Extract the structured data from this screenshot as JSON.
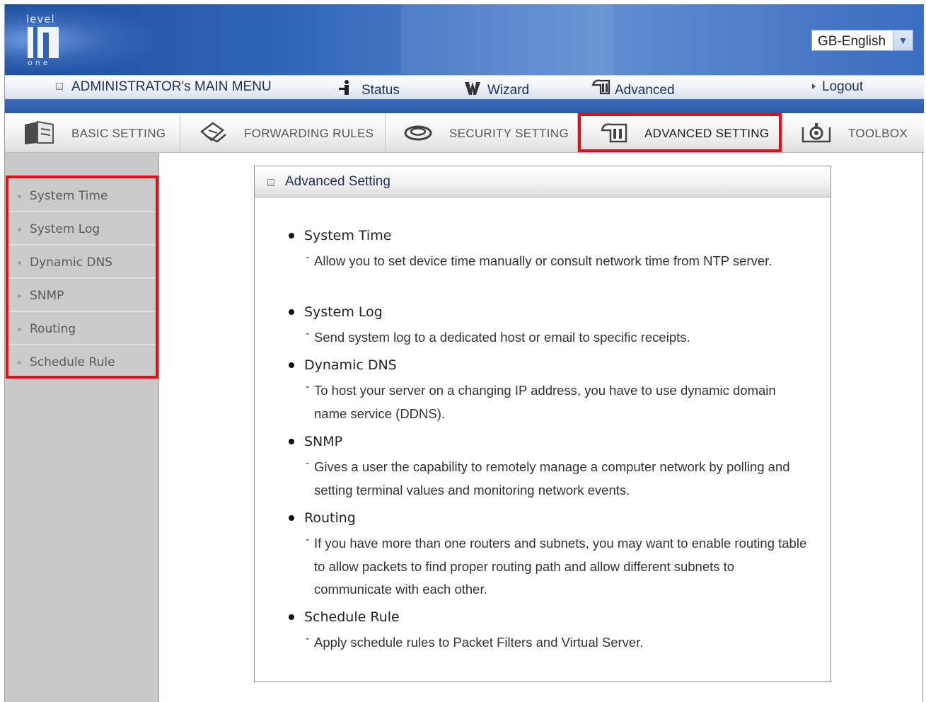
{
  "header": {
    "logo_top": "level",
    "logo_bottom": "one",
    "language": "GB-English"
  },
  "main_menu": {
    "admin_label": "ADMINISTRATOR's MAIN MENU",
    "status": "Status",
    "wizard": "Wizard",
    "advanced": "Advanced",
    "logout": "Logout"
  },
  "tabs": [
    {
      "label": "BASIC SETTING"
    },
    {
      "label": "FORWARDING RULES"
    },
    {
      "label": "SECURITY SETTING"
    },
    {
      "label": "ADVANCED SETTING"
    },
    {
      "label": "TOOLBOX"
    }
  ],
  "sidebar": {
    "items": [
      {
        "label": "System Time"
      },
      {
        "label": "System Log"
      },
      {
        "label": "Dynamic DNS"
      },
      {
        "label": "SNMP"
      },
      {
        "label": "Routing"
      },
      {
        "label": "Schedule Rule"
      }
    ]
  },
  "panel": {
    "title": "Advanced Setting",
    "entries": [
      {
        "title": "System Time",
        "desc": "Allow you to set device time manually or consult network time from NTP server."
      },
      {
        "title": "System Log",
        "desc": "Send system log to a dedicated host or email to specific receipts."
      },
      {
        "title": "Dynamic DNS",
        "desc": "To host your server on a changing IP address, you have to use dynamic domain name service (DDNS)."
      },
      {
        "title": "SNMP",
        "desc": "Gives a user the capability to remotely manage a computer network by polling and setting terminal values and monitoring network events."
      },
      {
        "title": "Routing",
        "desc": "If you have more than one routers and subnets, you may want to enable routing table to allow packets to find proper routing path and allow different subnets to communicate with each other."
      },
      {
        "title": "Schedule Rule",
        "desc": "Apply schedule rules to Packet Filters and Virtual Server."
      }
    ]
  },
  "colors": {
    "header_blue": "#2f64b8",
    "highlight_red": "#e0101a",
    "sidebar_gray": "#c9c9c9"
  }
}
